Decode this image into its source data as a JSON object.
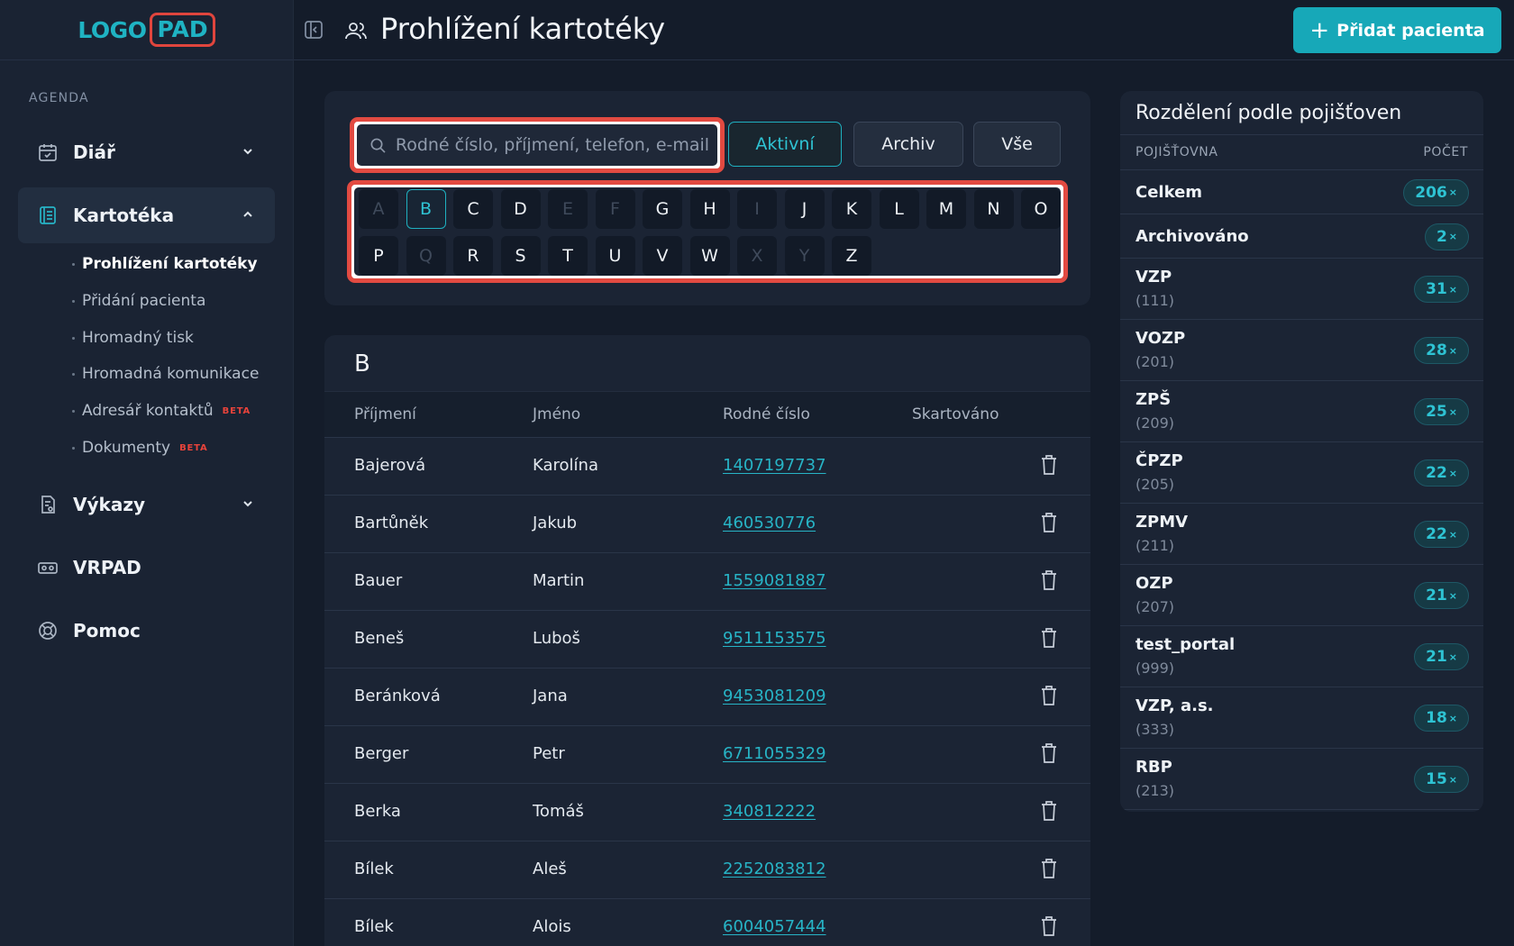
{
  "logo": {
    "left": "LOGO",
    "right": "PAD"
  },
  "sidebar": {
    "section_label": "AGENDA",
    "items": [
      {
        "label": "Diář",
        "icon": "calendar-check-icon"
      },
      {
        "label": "Kartotéka",
        "icon": "card-index-icon"
      },
      {
        "label": "Výkazy",
        "icon": "report-icon"
      },
      {
        "label": "VRPAD",
        "icon": "vr-headset-icon"
      },
      {
        "label": "Pomoc",
        "icon": "lifebuoy-icon"
      }
    ],
    "sub_items": [
      {
        "label": "Prohlížení kartotéky",
        "badge": ""
      },
      {
        "label": "Přidání pacienta",
        "badge": ""
      },
      {
        "label": "Hromadný tisk",
        "badge": ""
      },
      {
        "label": "Hromadná komunikace",
        "badge": ""
      },
      {
        "label": "Adresář kontaktů",
        "badge": "BETA"
      },
      {
        "label": "Dokumenty",
        "badge": "BETA"
      }
    ]
  },
  "header": {
    "title": "Prohlížení kartotéky",
    "add_button": "Přidat pacienta"
  },
  "filters": {
    "search_placeholder": "Rodné číslo, příjmení, telefon, e-mail",
    "active": "Aktivní",
    "archive": "Archiv",
    "all": "Vše"
  },
  "alphabet": {
    "row1": [
      "A",
      "B",
      "C",
      "D",
      "E",
      "F",
      "G",
      "H",
      "I",
      "J",
      "K",
      "L",
      "M",
      "N",
      "O"
    ],
    "row2": [
      "P",
      "Q",
      "R",
      "S",
      "T",
      "U",
      "V",
      "W",
      "X",
      "Y",
      "Z"
    ],
    "disabled": [
      "A",
      "E",
      "F",
      "I",
      "Q",
      "X",
      "Y"
    ],
    "selected": "B"
  },
  "table": {
    "group_letter": "B",
    "headers": [
      "Příjmení",
      "Jméno",
      "Rodné číslo",
      "Skartováno"
    ],
    "rows": [
      [
        "Bajerová",
        "Karolína",
        "1407197737"
      ],
      [
        "Bartůněk",
        "Jakub",
        "460530776"
      ],
      [
        "Bauer",
        "Martin",
        "1559081887"
      ],
      [
        "Beneš",
        "Luboš",
        "9511153575"
      ],
      [
        "Beránková",
        "Jana",
        "9453081209"
      ],
      [
        "Berger",
        "Petr",
        "6711055329"
      ],
      [
        "Berka",
        "Tomáš",
        "340812222"
      ],
      [
        "Bílek",
        "Aleš",
        "2252083812"
      ],
      [
        "Bílek",
        "Alois",
        "6004057444"
      ]
    ]
  },
  "insurance": {
    "title": "Rozdělení podle pojišťoven",
    "col_name": "POJIŠŤOVNA",
    "col_count": "POČET",
    "rows": [
      {
        "name": "Celkem",
        "code": "",
        "count": "206"
      },
      {
        "name": "Archivováno",
        "code": "",
        "count": "2"
      },
      {
        "name": "VZP",
        "code": "(111)",
        "count": "31"
      },
      {
        "name": "VOZP",
        "code": "(201)",
        "count": "28"
      },
      {
        "name": "ZPŠ",
        "code": "(209)",
        "count": "25"
      },
      {
        "name": "ČPZP",
        "code": "(205)",
        "count": "22"
      },
      {
        "name": "ZPMV",
        "code": "(211)",
        "count": "22"
      },
      {
        "name": "OZP",
        "code": "(207)",
        "count": "21"
      },
      {
        "name": "test_portal",
        "code": "(999)",
        "count": "21"
      },
      {
        "name": "VZP, a.s.",
        "code": "(333)",
        "count": "18"
      },
      {
        "name": "RBP",
        "code": "(213)",
        "count": "15"
      }
    ],
    "count_suffix": "×"
  },
  "colors": {
    "accent": "#17a8b8",
    "highlight": "#e24a41",
    "background": "#141c2a"
  }
}
